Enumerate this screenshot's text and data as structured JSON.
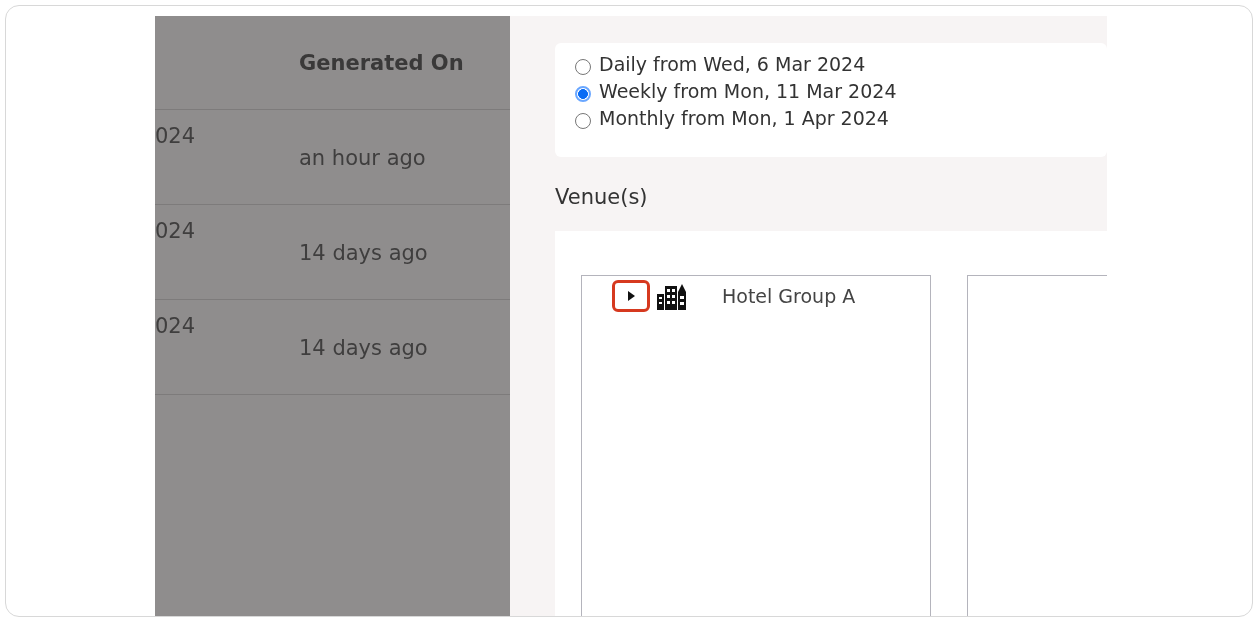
{
  "table": {
    "columns": [
      "Generated On"
    ],
    "rows": [
      {
        "column_1": "024",
        "generated_on": "an hour ago"
      },
      {
        "column_1": "024",
        "generated_on": "14 days ago"
      },
      {
        "column_1": "024",
        "generated_on": "14 days ago"
      }
    ]
  },
  "schedule": {
    "options": [
      {
        "label": "Daily from Wed, 6 Mar 2024",
        "selected": false
      },
      {
        "label": "Weekly from Mon, 11 Mar 2024",
        "selected": true
      },
      {
        "label": "Monthly from Mon, 1 Apr 2024",
        "selected": false
      }
    ]
  },
  "venues": {
    "heading": "Venue(s)",
    "tree": [
      {
        "label": "Hotel Group A",
        "expanded": false,
        "highlighted": true
      }
    ]
  }
}
